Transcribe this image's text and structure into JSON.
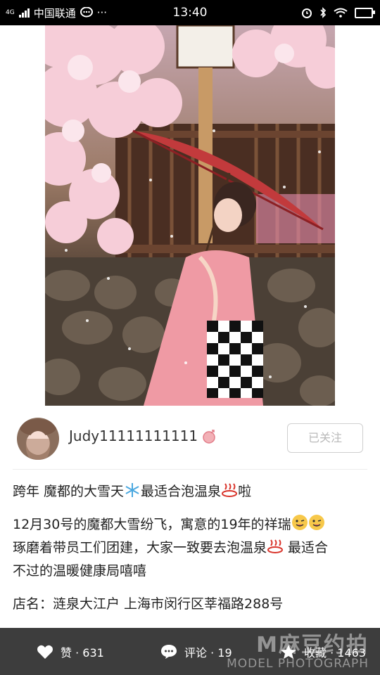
{
  "status_bar": {
    "carrier": "中国联通",
    "network": "4G",
    "time": "13:40",
    "extra": "···"
  },
  "photo": {
    "description_icon": "kimono-photo"
  },
  "author": {
    "name": "Judy11111111111",
    "follow_label": "已关注"
  },
  "post": {
    "title_1": "跨年 魔都的大雪天",
    "title_2": "最适合泡温泉",
    "title_3": "啦",
    "body_line1_a": "12月30号的魔都大雪纷飞，寓意的19年的祥瑞",
    "body_line2_a": "琢磨着带员工们团建，大家一致要去泡温泉",
    "body_line2_b": " 最适合",
    "body_line3": "不过的温暖健康局嘻嘻",
    "shop": "店名：涟泉大江户 上海市闵行区莘福路288号"
  },
  "actions": {
    "like": "赞 · 631",
    "comment": "评论 · 19",
    "collect": "收藏 · 1463"
  },
  "watermark": {
    "top": "M麻豆约拍",
    "bottom": "MODEL PHOTOGRAPH"
  },
  "colors": {
    "bottom_bar": "#3d3d3d",
    "accent_pink": "#f08a9a"
  }
}
